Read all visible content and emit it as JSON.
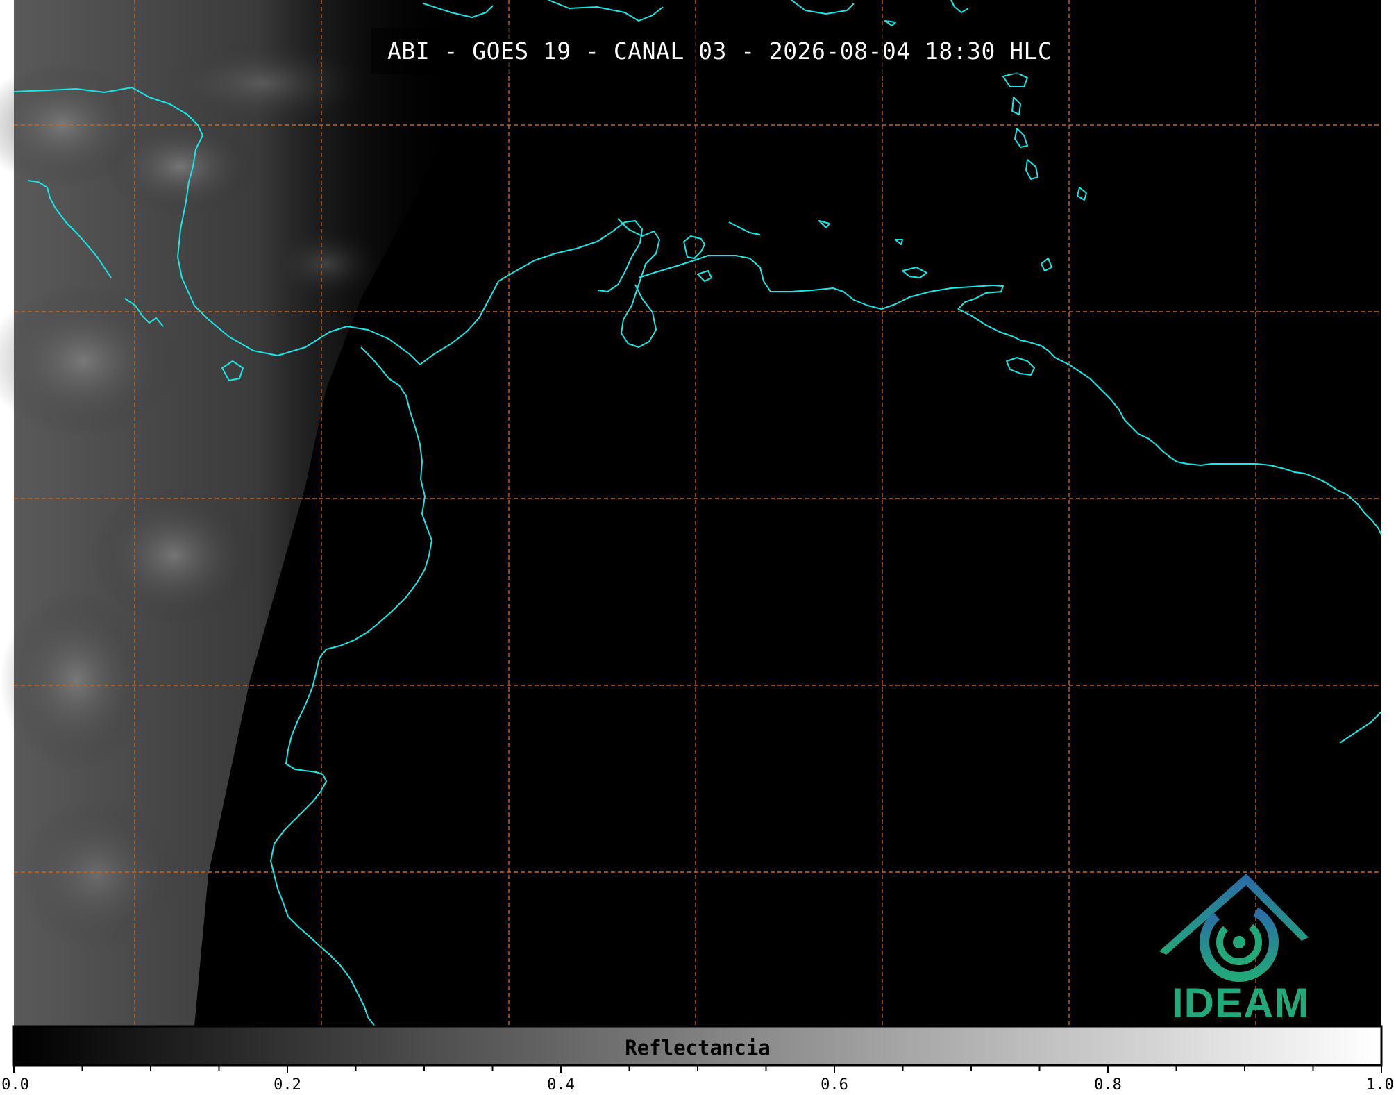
{
  "title": "ABI - GOES 19 - CANAL 03 - 2026-08-04 18:30 HLC",
  "colorbar": {
    "label": "Reflectancia",
    "ticks": [
      "0.0",
      "0.2",
      "0.4",
      "0.6",
      "0.8",
      "1.0"
    ],
    "range": [
      0.0,
      1.0
    ],
    "colormap": "grayscale"
  },
  "logo": {
    "text": "IDEAM"
  },
  "colors": {
    "coastline": "#19e6e6",
    "graticule": "#c8641e",
    "background": "#000000",
    "logo_green": "#23a87a",
    "logo_blue": "#2a6aa8"
  }
}
